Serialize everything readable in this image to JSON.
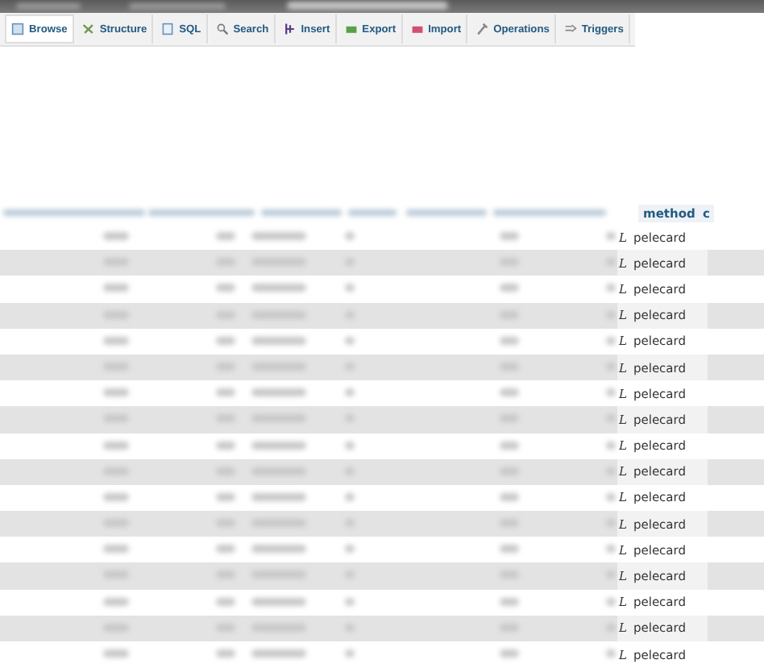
{
  "tabs": [
    {
      "label": "Browse",
      "selected": true
    },
    {
      "label": "Structure",
      "selected": false
    },
    {
      "label": "SQL",
      "selected": false
    },
    {
      "label": "Search",
      "selected": false
    },
    {
      "label": "Insert",
      "selected": false
    },
    {
      "label": "Export",
      "selected": false
    },
    {
      "label": "Import",
      "selected": false
    },
    {
      "label": "Operations",
      "selected": false
    },
    {
      "label": "Triggers",
      "selected": false
    }
  ],
  "table": {
    "columns": [
      "method",
      "c"
    ],
    "rows": [
      {
        "marker": "L",
        "method": "pelecard"
      },
      {
        "marker": "L",
        "method": "pelecard"
      },
      {
        "marker": "L",
        "method": "pelecard"
      },
      {
        "marker": "L",
        "method": "pelecard"
      },
      {
        "marker": "L",
        "method": "pelecard"
      },
      {
        "marker": "L",
        "method": "pelecard"
      },
      {
        "marker": "L",
        "method": "pelecard"
      },
      {
        "marker": "L",
        "method": "pelecard"
      },
      {
        "marker": "L",
        "method": "pelecard"
      },
      {
        "marker": "L",
        "method": "pelecard"
      },
      {
        "marker": "L",
        "method": "pelecard"
      },
      {
        "marker": "L",
        "method": "pelecard"
      },
      {
        "marker": "L",
        "method": "pelecard"
      },
      {
        "marker": "L",
        "method": "pelecard"
      },
      {
        "marker": "L",
        "method": "pelecard"
      },
      {
        "marker": "L",
        "method": "pelecard"
      },
      {
        "marker": "L",
        "method": "pelecard"
      }
    ]
  }
}
